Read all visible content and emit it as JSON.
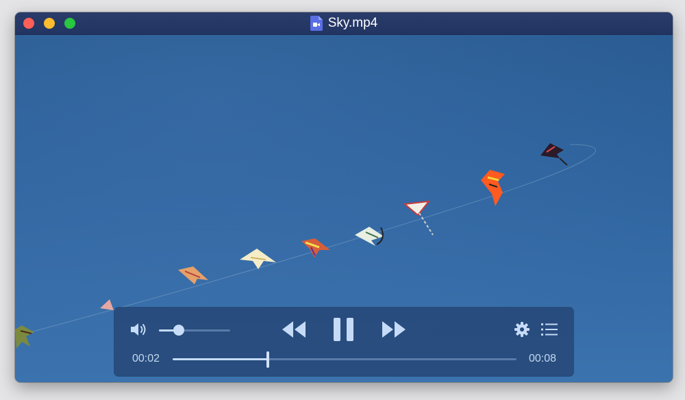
{
  "window": {
    "title": "Sky.mp4",
    "file_icon": "video-file-icon"
  },
  "controls": {
    "volume_icon": "speaker-volume-icon",
    "volume_level": 0.28,
    "rewind_icon": "rewind-icon",
    "pause_icon": "pause-icon",
    "fast_forward_icon": "fast-forward-icon",
    "settings_icon": "gear-icon",
    "playlist_icon": "list-icon",
    "current_time": "00:02",
    "duration": "00:08",
    "progress": 0.276
  },
  "colors": {
    "titlebar": "#26386a",
    "sky": "#2f649e",
    "controls_bg": "#264878",
    "controls_fg": "#c6dbf7"
  }
}
